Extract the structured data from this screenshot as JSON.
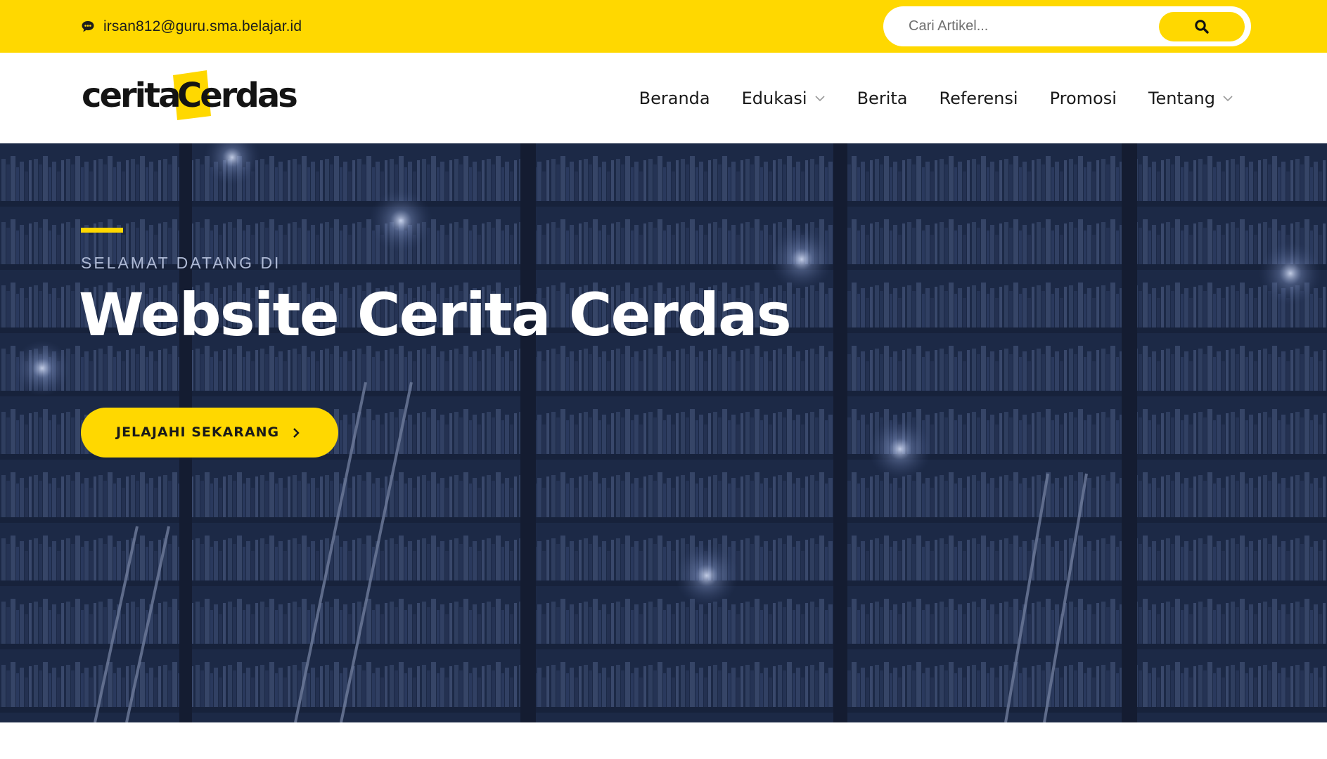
{
  "topbar": {
    "email": "irsan812@guru.sma.belajar.id",
    "search_placeholder": "Cari Artikel...",
    "icons": {
      "email": "chat-bubble-icon",
      "search": "search-icon"
    }
  },
  "logo": {
    "part1": "cerita",
    "part2": "Cerdas"
  },
  "nav": {
    "items": [
      {
        "label": "Beranda",
        "dropdown": false
      },
      {
        "label": "Edukasi",
        "dropdown": true
      },
      {
        "label": "Berita",
        "dropdown": false
      },
      {
        "label": "Referensi",
        "dropdown": false
      },
      {
        "label": "Promosi",
        "dropdown": false
      },
      {
        "label": "Tentang",
        "dropdown": true
      }
    ]
  },
  "hero": {
    "kicker": "SELAMAT DATANG DI",
    "title": "Website Cerita Cerdas",
    "cta_label": "JELAJAHI SEKARANG"
  },
  "colors": {
    "accent": "#FFD800",
    "hero_overlay": "#1b2744",
    "text_dark": "#1a1a1a"
  }
}
